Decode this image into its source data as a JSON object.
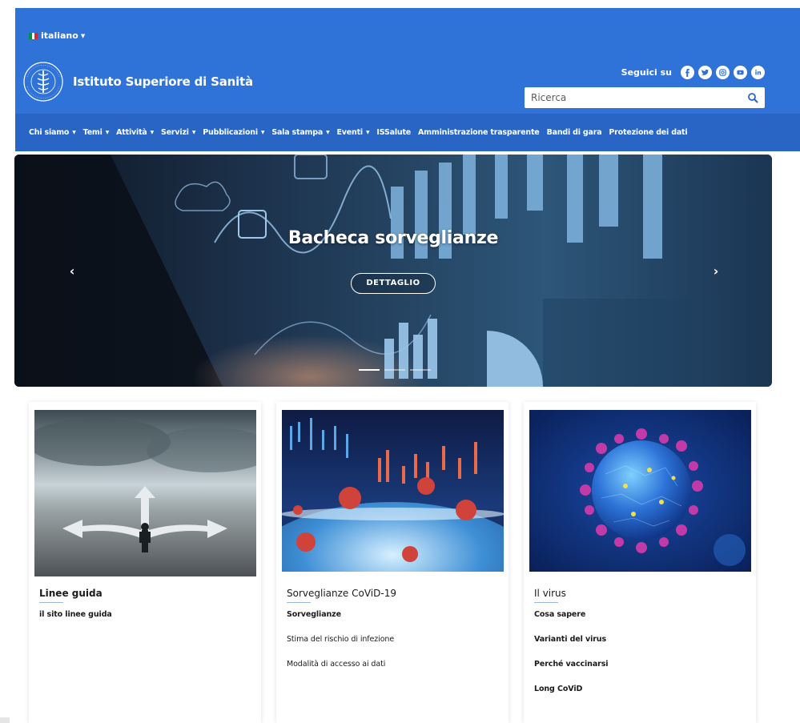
{
  "header": {
    "language": "italiano",
    "flag_colors": [
      "#009246",
      "#ffffff",
      "#ce2b37"
    ],
    "site_title": "Istituto Superiore di Sanità",
    "follow_label": "Seguici su",
    "social_icons": [
      "facebook-icon",
      "twitter-icon",
      "instagram-icon",
      "youtube-icon",
      "linkedin-icon"
    ],
    "search_placeholder": "Ricerca",
    "background_color": "#2f73d9"
  },
  "nav": {
    "background_color": "#2865c4",
    "items": [
      {
        "label": "Chi siamo",
        "dropdown": true
      },
      {
        "label": "Temi",
        "dropdown": true
      },
      {
        "label": "Attività",
        "dropdown": true
      },
      {
        "label": "Servizi",
        "dropdown": true
      },
      {
        "label": "Pubblicazioni",
        "dropdown": true
      },
      {
        "label": "Sala stampa",
        "dropdown": true
      },
      {
        "label": "Eventi",
        "dropdown": true
      },
      {
        "label": "ISSalute",
        "dropdown": false
      },
      {
        "label": "Amministrazione trasparente",
        "dropdown": false
      },
      {
        "label": "Bandi di gara",
        "dropdown": false
      },
      {
        "label": "Protezione dei dati",
        "dropdown": false
      }
    ]
  },
  "hero": {
    "title": "Bacheca sorveglianze",
    "button_label": "DETTAGLIO",
    "prev_arrow": "‹",
    "next_arrow": "›",
    "slide_count": 3,
    "active_slide": 1
  },
  "cards": [
    {
      "title": "Linee guida",
      "links": [
        "il sito linee guida"
      ]
    },
    {
      "title": "Sorveglianze CoViD-19",
      "links": [
        "Sorveglianze",
        "Stima del rischio di infezione",
        "Modalità di accesso ai dati"
      ]
    },
    {
      "title": "Il virus",
      "links": [
        "Cosa sapere",
        "Varianti del virus",
        "Perché vaccinarsi",
        "Long CoViD"
      ]
    }
  ]
}
